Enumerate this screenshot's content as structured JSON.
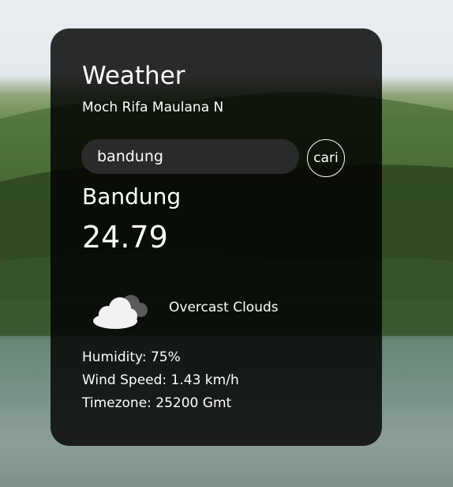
{
  "app": {
    "title": "Weather",
    "author": "Moch Rifa Maulana N"
  },
  "search": {
    "value": "bandung",
    "button_label": "cari"
  },
  "weather": {
    "city": "Bandung",
    "temperature": "24.79",
    "icon": "overcast-clouds-icon",
    "description": "Overcast Clouds"
  },
  "details": {
    "humidity": "Humidity: 75%",
    "wind_speed": "Wind Speed: 1.43 km/h",
    "timezone": "Timezone: 25200 Gmt"
  }
}
